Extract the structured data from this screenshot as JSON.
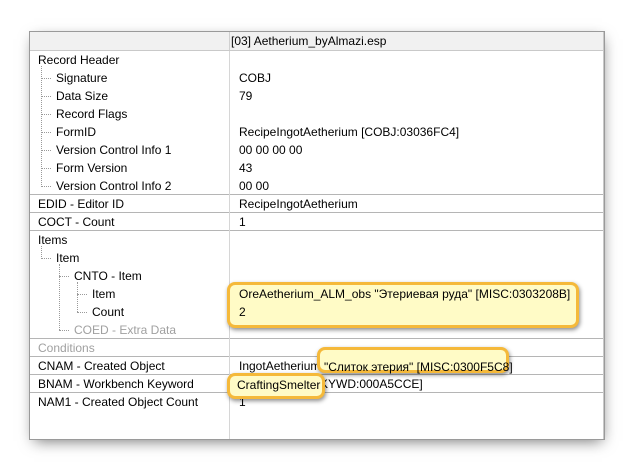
{
  "header": {
    "filename": "[03] Aetherium_byAlmazi.esp"
  },
  "rows": {
    "record_header": {
      "label": "Record Header",
      "value": ""
    },
    "signature": {
      "label": "Signature",
      "value": "COBJ"
    },
    "data_size": {
      "label": "Data Size",
      "value": "79"
    },
    "record_flags": {
      "label": "Record Flags",
      "value": ""
    },
    "formid": {
      "label": "FormID",
      "value": "RecipeIngotAetherium [COBJ:03036FC4]"
    },
    "vci1": {
      "label": "Version Control Info 1",
      "value": "00 00 00 00"
    },
    "form_version": {
      "label": "Form Version",
      "value": "43"
    },
    "vci2": {
      "label": "Version Control Info 2",
      "value": "00 00"
    },
    "edid": {
      "label": "EDID - Editor ID",
      "value": "RecipeIngotAetherium"
    },
    "coct": {
      "label": "COCT - Count",
      "value": "1"
    },
    "items": {
      "label": "Items",
      "value": ""
    },
    "item_group": {
      "label": "Item",
      "value": ""
    },
    "cnto": {
      "label": "CNTO - Item",
      "value": ""
    },
    "cnto_item": {
      "label": "Item",
      "value": "OreAetherium_ALM_obs \"Этериевая руда\" [MISC:0303208B]"
    },
    "cnto_count": {
      "label": "Count",
      "value": "2"
    },
    "coed": {
      "label": "COED - Extra Data",
      "value": ""
    },
    "conditions": {
      "label": "Conditions",
      "value": ""
    },
    "cnam": {
      "label": "CNAM - Created Object",
      "value_prefix": "IngotAetherium",
      "value_highlight": "\"Слиток этерия\" [MISC:0300F5C8]"
    },
    "bnam": {
      "label": "BNAM - Workbench Keyword",
      "value_highlight": "CraftingSmelter",
      "value_suffix": "KYWD:000A5CCE]"
    },
    "nam1": {
      "label": "NAM1 - Created Object Count",
      "value": "1"
    }
  },
  "colors": {
    "highlight_border": "#f5b93a",
    "highlight_fill": "#fffbc6",
    "disabled_text": "#a0a0a0"
  }
}
